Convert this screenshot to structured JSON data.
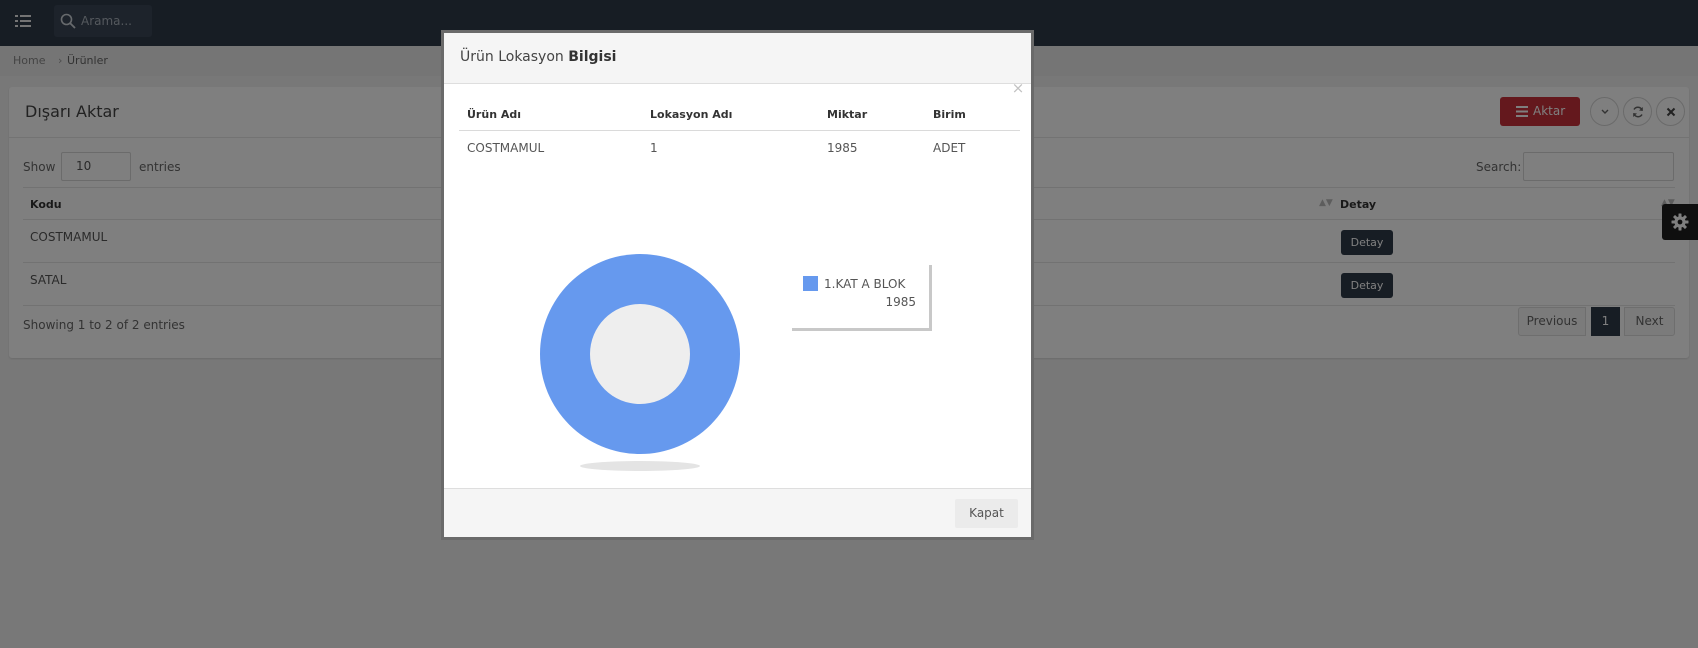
{
  "topbar": {
    "menu_icon": "list-menu-icon",
    "search_icon": "search-icon",
    "search_placeholder": "Arama..."
  },
  "breadcrumb": {
    "home": "Home",
    "separator": "›",
    "current": "Ürünler"
  },
  "panel": {
    "title": "Dışarı Aktar",
    "export_label": "Aktar",
    "export_icon": "bars-icon",
    "tool_icons": [
      "chevron-down-icon",
      "refresh-icon",
      "close-icon"
    ],
    "show_label": "Show",
    "length_value": "10",
    "entries_label": "entries",
    "filter_label": "Search:",
    "filter_value": "",
    "table": {
      "columns": [
        "Kodu",
        "Detay"
      ],
      "rows": [
        {
          "kodu": "COSTMAMUL",
          "detay_label": "Detay"
        },
        {
          "kodu": "SATAL",
          "detay_label": "Detay"
        }
      ]
    },
    "info": "Showing 1 to 2 of 2 entries",
    "pagination": {
      "previous": "Previous",
      "current": "1",
      "next": "Next"
    }
  },
  "settings": {
    "icon": "gear-icon"
  },
  "modal": {
    "title_plain": "Ürün Lokasyon ",
    "title_bold": "Bilgisi",
    "close_symbol": "×",
    "table": {
      "columns": [
        "Ürün Adı",
        "Lokasyon Adı",
        "Miktar",
        "Birim"
      ],
      "rows": [
        {
          "urun": "COSTMAMUL",
          "lokasyon": "1",
          "miktar": "1985",
          "birim": "ADET"
        }
      ]
    },
    "close_button": "Kapat"
  },
  "chart_data": {
    "type": "pie",
    "style": "donut",
    "labels": [
      "1.KAT A BLOK"
    ],
    "values": [
      1985
    ],
    "colors": [
      "#6699ee"
    ],
    "hole_color": "#eeeeee",
    "legend": "right"
  }
}
